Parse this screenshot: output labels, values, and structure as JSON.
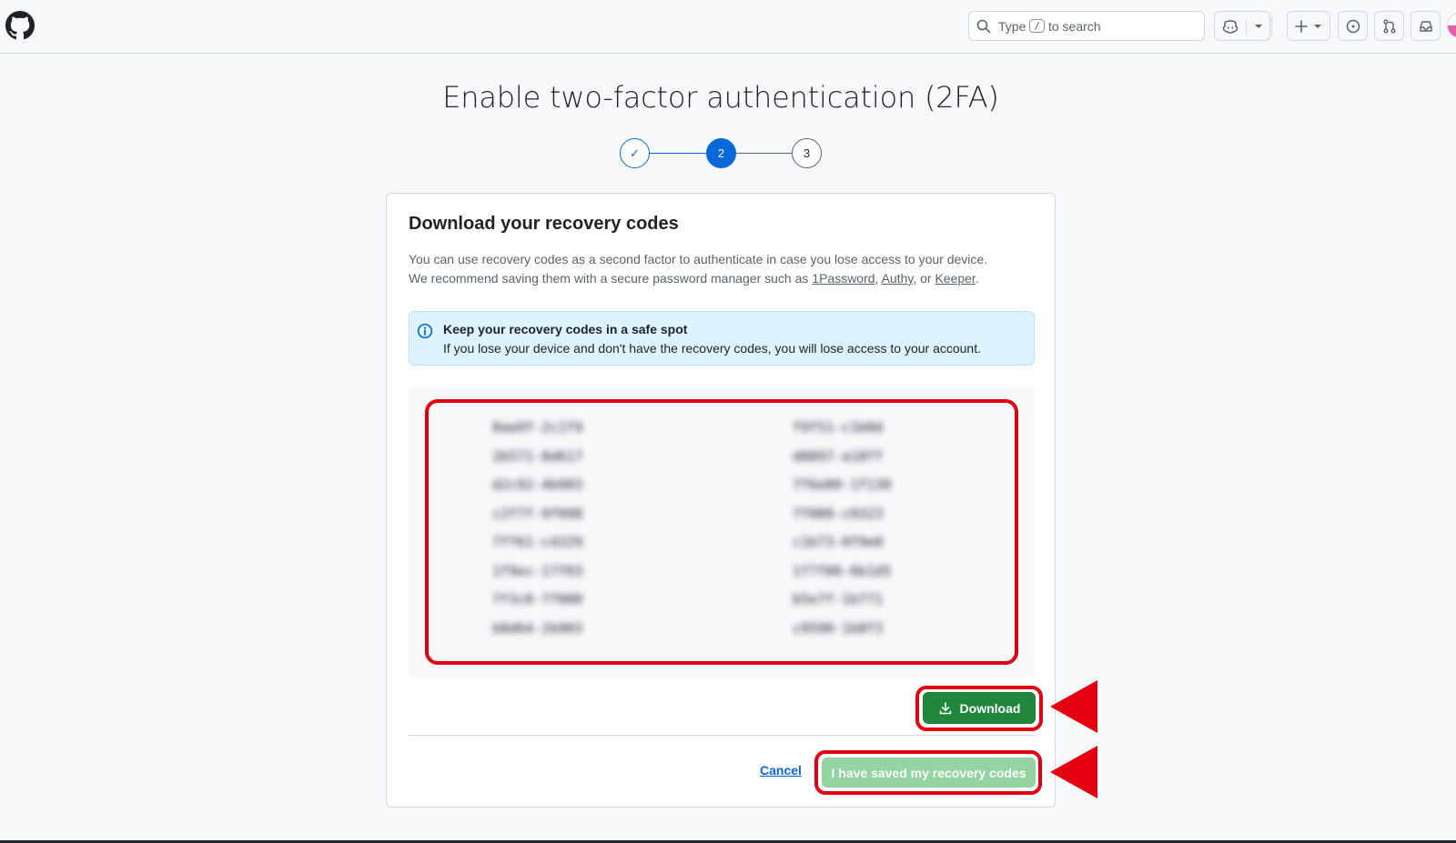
{
  "header": {
    "logo": "github-logo",
    "search": {
      "prefix": "Type",
      "key": "/",
      "suffix": "to search"
    },
    "icons": [
      "copilot-icon",
      "chevron-down-icon",
      "plus-icon",
      "issues-icon",
      "pull-request-icon",
      "inbox-icon"
    ]
  },
  "page": {
    "title": "Enable two-factor authentication (2FA)",
    "steps": [
      {
        "label": "✓",
        "state": "complete"
      },
      {
        "label": "2",
        "state": "current"
      },
      {
        "label": "3",
        "state": "upcoming"
      }
    ]
  },
  "card": {
    "heading": "Download your recovery codes",
    "description": {
      "text_before": "You can use recovery codes as a second factor to authenticate in case you lose access to your device. We recommend saving them with a secure password manager such as",
      "link_1": "1Password",
      "sep_1": ",",
      "link_2": "Authy",
      "sep_2": ", or",
      "link_3": "Keeper",
      "end": "."
    },
    "flash": {
      "icon": "info-icon",
      "title": "Keep your recovery codes in a safe spot",
      "body": "If you lose your device and don't have the recovery codes, you will lose access to your account."
    },
    "codes": [
      "8aa9f-2c1f9",
      "f9f51-c1b0d",
      "2b571-8d617",
      "d8897-a18ff",
      "d2c92-4b903",
      "7f6e80-1f130",
      "c2f7f-9f098",
      "7f080-c0323",
      "7ff61-c4329",
      "c1b73-0f9e0",
      "1f9ec-17f03",
      "1f7f80-6b1d5",
      "7f3c0-7f080",
      "b5e7f-1b771",
      "b8d64-2b903",
      "c9590-1b8f3"
    ],
    "download_button": {
      "icon": "download-icon",
      "label": "Download"
    },
    "cancel_label": "Cancel",
    "saved_button_label": "I have saved my recovery codes"
  },
  "annotations": {
    "highlight_color": "#e3000f"
  }
}
